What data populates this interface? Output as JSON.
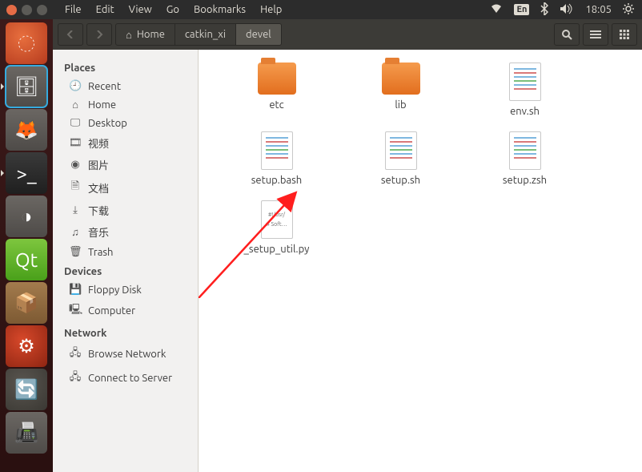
{
  "menubar": [
    "File",
    "Edit",
    "View",
    "Go",
    "Bookmarks",
    "Help"
  ],
  "panel": {
    "lang": "En",
    "time": "18:05"
  },
  "toolbar": {
    "crumbs": [
      {
        "label": "Home",
        "home": true
      },
      {
        "label": "catkin_xi"
      },
      {
        "label": "devel",
        "active": true
      }
    ]
  },
  "sidebar": {
    "sections": [
      {
        "title": "Places",
        "items": [
          {
            "icon": "🕘",
            "label": "Recent",
            "name": "recent"
          },
          {
            "icon": "⌂",
            "label": "Home",
            "name": "home"
          },
          {
            "icon": "🖵",
            "label": "Desktop",
            "name": "desktop"
          },
          {
            "icon": "🎞",
            "label": "视频",
            "name": "videos"
          },
          {
            "icon": "◉",
            "label": "图片",
            "name": "pictures"
          },
          {
            "icon": "🗎",
            "label": "文档",
            "name": "documents"
          },
          {
            "icon": "⤓",
            "label": "下载",
            "name": "downloads"
          },
          {
            "icon": "♫",
            "label": "音乐",
            "name": "music"
          },
          {
            "icon": "🗑",
            "label": "Trash",
            "name": "trash"
          }
        ]
      },
      {
        "title": "Devices",
        "items": [
          {
            "icon": "💾",
            "label": "Floppy Disk",
            "name": "floppy"
          },
          {
            "icon": "🖳",
            "label": "Computer",
            "name": "computer"
          }
        ]
      },
      {
        "title": "Network",
        "items": [
          {
            "icon": "🖧",
            "label": "Browse Network",
            "name": "browse-network"
          },
          {
            "icon": "🖧",
            "label": "Connect to Server",
            "name": "connect-server"
          }
        ]
      }
    ]
  },
  "files": [
    {
      "name": "etc",
      "type": "folder"
    },
    {
      "name": "lib",
      "type": "folder"
    },
    {
      "name": "env.sh",
      "type": "script"
    },
    {
      "name": "setup.bash",
      "type": "script"
    },
    {
      "name": "setup.sh",
      "type": "script"
    },
    {
      "name": "setup.zsh",
      "type": "script"
    },
    {
      "name": "_setup_util.py",
      "type": "python"
    }
  ],
  "launcher": [
    {
      "name": "dash",
      "cls": "li-dash",
      "glyph": "◌"
    },
    {
      "name": "files",
      "cls": "li-files",
      "glyph": "🗄",
      "running": true
    },
    {
      "name": "firefox",
      "cls": "li-firefox",
      "glyph": "🦊"
    },
    {
      "name": "terminal",
      "cls": "li-term",
      "glyph": ">_",
      "running": true
    },
    {
      "name": "eclipse",
      "cls": "li-eclipse",
      "glyph": "◑"
    },
    {
      "name": "qt",
      "cls": "li-qt",
      "glyph": "Qt"
    },
    {
      "name": "package",
      "cls": "li-pkg",
      "glyph": "📦"
    },
    {
      "name": "settings",
      "cls": "li-gear",
      "glyph": "⚙"
    },
    {
      "name": "updater",
      "cls": "li-upd",
      "glyph": "🔄"
    },
    {
      "name": "scanner",
      "cls": "li-scan",
      "glyph": "📠"
    }
  ]
}
